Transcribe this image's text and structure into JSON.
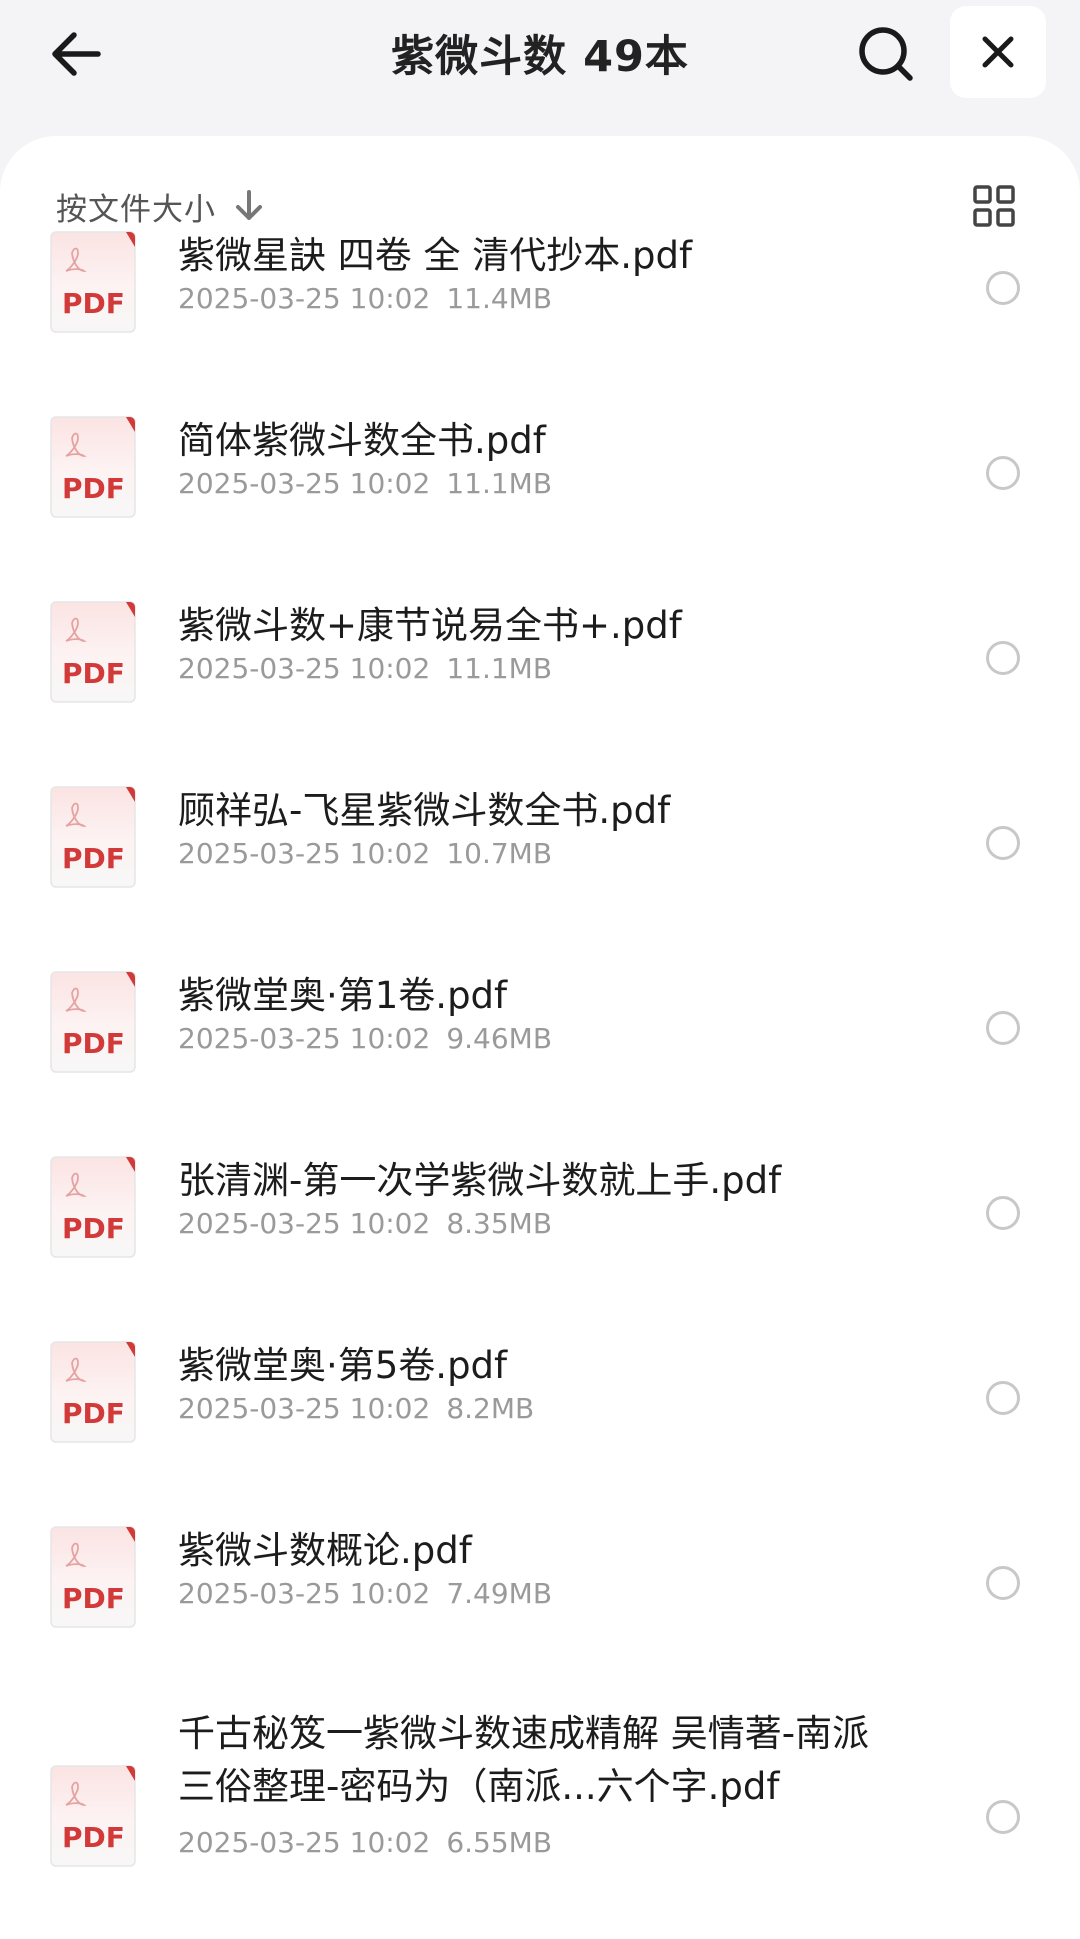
{
  "header": {
    "title": "紫微斗数 49本"
  },
  "icons": {
    "back": "arrow-left-icon",
    "search": "search-icon",
    "close": "close-icon",
    "sort": "arrow-down-icon",
    "grid": "grid-view-icon",
    "file": "pdf-file-icon"
  },
  "colors": {
    "pdf_red": "#d23a3a",
    "meta_gray": "#9a9a9a",
    "background": "#f4f4f6"
  },
  "sort": {
    "label": "按文件大小"
  },
  "pdf_badge": "PDF",
  "files": [
    {
      "name": "紫微星訣 四卷 全 清代抄本.pdf",
      "date": "2025-03-25 10:02",
      "size": "11.4MB"
    },
    {
      "name": "简体紫微斗数全书.pdf",
      "date": "2025-03-25 10:02",
      "size": "11.1MB"
    },
    {
      "name": "紫微斗数+康节说易全书+.pdf",
      "date": "2025-03-25 10:02",
      "size": "11.1MB"
    },
    {
      "name": "顾祥弘-飞星紫微斗数全书.pdf",
      "date": "2025-03-25 10:02",
      "size": "10.7MB"
    },
    {
      "name": "紫微堂奥·第1卷.pdf",
      "date": "2025-03-25 10:02",
      "size": "9.46MB"
    },
    {
      "name": "张清渊-第一次学紫微斗数就上手.pdf",
      "date": "2025-03-25 10:02",
      "size": "8.35MB"
    },
    {
      "name": "紫微堂奥·第5卷.pdf",
      "date": "2025-03-25 10:02",
      "size": "8.2MB"
    },
    {
      "name": "紫微斗数概论.pdf",
      "date": "2025-03-25 10:02",
      "size": "7.49MB"
    },
    {
      "name": "千古秘笈一紫微斗数速成精解 吴情著-南派三俗整理-密码为（南派...六个字.pdf",
      "date": "2025-03-25 10:02",
      "size": "6.55MB"
    }
  ]
}
